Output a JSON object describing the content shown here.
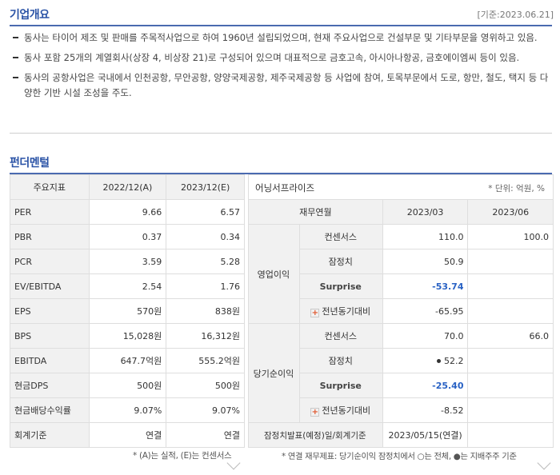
{
  "overview": {
    "title": "기업개요",
    "date": "[기준:2023.06.21]",
    "items": [
      "동사는 타이어 제조 및 판매를 주목적사업으로 하여 1960년 설립되었으며, 현재 주요사업으로 건설부문 및 기타부문을 영위하고 있음.",
      "동사 포함 25개의 계열회사(상장 4, 비상장 21)로 구성되어 있으며 대표적으로 금호고속, 아시아나항공, 금호에이엠씨 등이 있음.",
      "동사의 공항사업은 국내에서 인천공항, 무안공항, 양양국제공항, 제주국제공항 등 사업에 참여, 토목부문에서 도로, 항만, 철도, 택지 등 다양한 기반 시설 조성을 주도."
    ]
  },
  "fundamental": {
    "title": "펀더멘털",
    "headers": [
      "주요지표",
      "2022/12(A)",
      "2023/12(E)"
    ],
    "rows": [
      [
        "PER",
        "9.66",
        "6.57"
      ],
      [
        "PBR",
        "0.37",
        "0.34"
      ],
      [
        "PCR",
        "3.59",
        "5.28"
      ],
      [
        "EV/EBITDA",
        "2.54",
        "1.76"
      ],
      [
        "EPS",
        "570원",
        "838원"
      ],
      [
        "BPS",
        "15,028원",
        "16,312원"
      ],
      [
        "EBITDA",
        "647.7억원",
        "555.2억원"
      ],
      [
        "현금DPS",
        "500원",
        "500원"
      ],
      [
        "현금배당수익률",
        "9.07%",
        "9.07%"
      ],
      [
        "회계기준",
        "연결",
        "연결"
      ]
    ],
    "note": "* (A)는 실적, (E)는 컨센서스"
  },
  "earnings": {
    "title": "어닝서프라이즈",
    "unit": "* 단위: 억원, %",
    "col_header": "재무연월",
    "periods": [
      "2023/03",
      "2023/06"
    ],
    "op_label": "영업이익",
    "net_label": "당기순이익",
    "consensus": "컨센서스",
    "provisional": "잠정치",
    "surprise": "Surprise",
    "yoy": "전년동기대비",
    "op": {
      "consensus": [
        "110.0",
        "100.0"
      ],
      "provisional": [
        "50.9",
        ""
      ],
      "surprise": [
        "-53.74",
        ""
      ],
      "yoy": [
        "-65.95",
        ""
      ]
    },
    "net": {
      "consensus": [
        "70.0",
        "66.0"
      ],
      "provisional": [
        "52.2",
        ""
      ],
      "surprise": [
        "-25.40",
        ""
      ],
      "yoy": [
        "-8.52",
        ""
      ]
    },
    "release_label": "잠정치발표(예정)일/회계기준",
    "release_value": "2023/05/15(연결)",
    "note": "* 연결 재무제표: 당기순이익 잠정치에서 ○는 전체, ●는 지배주주 기준"
  }
}
